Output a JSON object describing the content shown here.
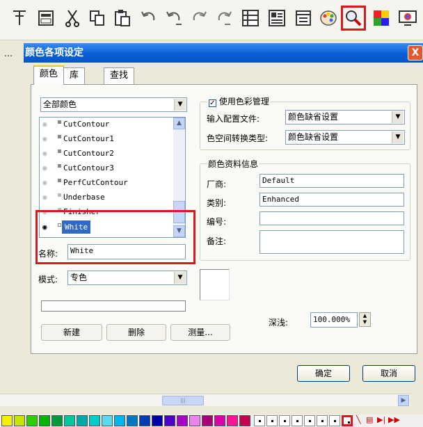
{
  "toolbar": {
    "icons": [
      "pin-icon",
      "app-icon",
      "cut-icon",
      "copy-icon",
      "paste-icon",
      "undo-icon",
      "undo-list-icon",
      "redo-icon",
      "redo-list-icon",
      "layout-icon",
      "layout2-icon",
      "document-icon",
      "palette-icon",
      "color-inspect-icon",
      "color-grid-icon",
      "monitor-icon"
    ]
  },
  "dialog": {
    "title": "颜色各项设定",
    "close_glyph": "X",
    "tabs": [
      "颜色",
      "库",
      "查找"
    ],
    "color_filter": "全部颜色",
    "color_list": [
      {
        "name": "CutContour",
        "visible": false
      },
      {
        "name": "CutContour1",
        "visible": false
      },
      {
        "name": "CutContour2",
        "visible": false
      },
      {
        "name": "CutContour3",
        "visible": false
      },
      {
        "name": "PerfCutContour",
        "visible": false
      },
      {
        "name": "Underbase",
        "visible": false
      },
      {
        "name": "Finisher",
        "visible": false
      },
      {
        "name": "White",
        "visible": true,
        "selected": true
      }
    ],
    "name_label": "名称:",
    "name_value": "White",
    "mode_label": "模式:",
    "mode_value": "专色",
    "buttons": {
      "new": "新建",
      "delete": "删除",
      "measure": "测量...",
      "ok": "确定",
      "cancel": "取消"
    },
    "color_management": {
      "checkbox_label": "使用色彩管理",
      "checked": true,
      "input_profile_label": "输入配置文件:",
      "input_profile_value": "颜色缺省设置",
      "space_convert_label": "色空间转换类型:",
      "space_convert_value": "颜色缺省设置"
    },
    "color_info": {
      "group_title": "颜色资料信息",
      "vendor_label": "厂商:",
      "vendor_value": "Default",
      "category_label": "类别:",
      "category_value": "Enhanced",
      "number_label": "编号:",
      "number_value": "",
      "note_label": "备注:",
      "note_value": ""
    },
    "depth_label": "深浅:",
    "depth_value": "100.000%"
  },
  "palette": {
    "colors": [
      "#f2f200",
      "#c6e600",
      "#2bd000",
      "#00b600",
      "#009a3c",
      "#00c8a0",
      "#00a8a8",
      "#00cccc",
      "#59d8ee",
      "#00b4f0",
      "#0078c8",
      "#003cb4",
      "#0000aa",
      "#5000c8",
      "#aa00c8",
      "#ee82ee",
      "#aa0078",
      "#dc00aa",
      "#ff1493",
      "#c80050"
    ]
  },
  "colors": {
    "titlebar": "#0a5fd8",
    "selection": "#316ac5",
    "highlight": "#d8191c"
  }
}
